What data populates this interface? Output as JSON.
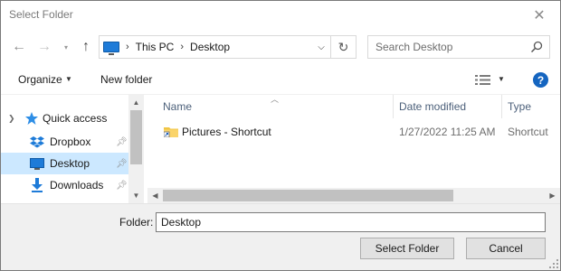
{
  "window": {
    "title": "Select Folder"
  },
  "nav": {
    "address": {
      "crumbs": [
        "This PC",
        "Desktop"
      ]
    },
    "search": {
      "placeholder": "Search Desktop"
    }
  },
  "commandbar": {
    "organize": "Organize",
    "new_folder": "New folder"
  },
  "navpane": {
    "items": [
      {
        "label": "Quick access",
        "icon": "star-icon"
      },
      {
        "label": "Dropbox",
        "icon": "dropbox-icon",
        "pinned": true
      },
      {
        "label": "Desktop",
        "icon": "desktop-icon",
        "pinned": true,
        "selected": true
      },
      {
        "label": "Downloads",
        "icon": "download-icon",
        "pinned": true
      }
    ]
  },
  "filelist": {
    "columns": [
      "Name",
      "Date modified",
      "Type"
    ],
    "rows": [
      {
        "name": "Pictures - Shortcut",
        "date": "1/27/2022 11:25 AM",
        "type": "Shortcut"
      }
    ]
  },
  "bottom": {
    "folder_label": "Folder:",
    "folder_value": "Desktop",
    "select_label": "Select Folder",
    "cancel_label": "Cancel"
  },
  "colors": {
    "accent": "#1e7bd8",
    "selection": "#cce8ff",
    "help": "#1565c0"
  }
}
